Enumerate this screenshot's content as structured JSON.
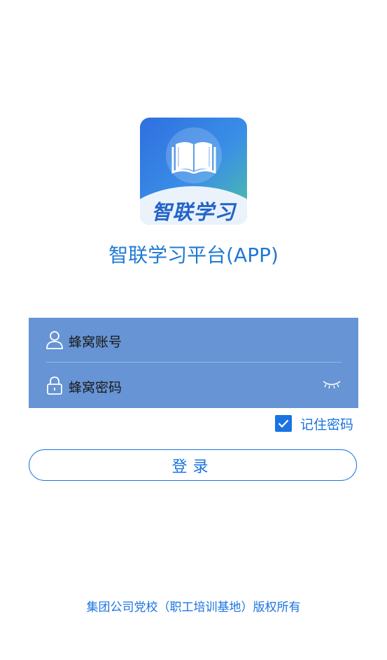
{
  "app": {
    "logo_text": "智联学习",
    "title": "智联学习平台(APP)"
  },
  "form": {
    "account_placeholder": "蜂窝账号",
    "password_placeholder": "蜂窝密码",
    "remember_label": "记住密码",
    "remember_checked": true,
    "login_label": "登录"
  },
  "footer": {
    "copyright": "集团公司党校（职工培训基地）版权所有"
  },
  "colors": {
    "accent": "#1a73e0",
    "panel": "#6694d4"
  },
  "icons": [
    "book-icon",
    "user-icon",
    "lock-icon",
    "eye-closed-icon",
    "check-icon"
  ]
}
